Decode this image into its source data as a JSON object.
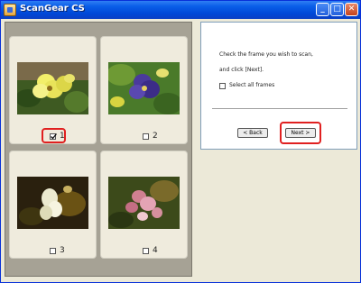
{
  "window": {
    "title": "ScanGear CS",
    "minimize_glyph": "_",
    "maximize_glyph": "□",
    "close_glyph": "✕"
  },
  "frames": [
    {
      "number": "1",
      "checked": true,
      "photo": "yellow-pansy-photo"
    },
    {
      "number": "2",
      "checked": false,
      "photo": "purple-pansy-photo"
    },
    {
      "number": "3",
      "checked": false,
      "photo": "white-flower-photo"
    },
    {
      "number": "4",
      "checked": false,
      "photo": "pink-flower-photo"
    }
  ],
  "instructions": {
    "line1": "Check the frame you wish to scan,",
    "line2": "and click [Next]."
  },
  "select_all": {
    "label": "Select all frames",
    "checked": false
  },
  "buttons": {
    "back": "< Back",
    "next": "Next >"
  },
  "colors": {
    "highlight": "#e02020",
    "titlebar": "#0a5ee8"
  }
}
